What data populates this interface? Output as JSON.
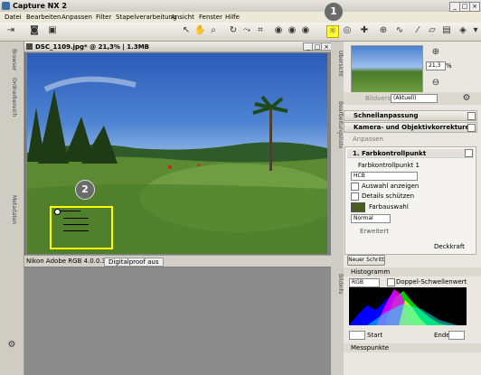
{
  "app": {
    "title": "Capture NX 2"
  },
  "menu": [
    "Datei",
    "Bearbeiten",
    "Anpassen",
    "Filter",
    "Stapelverarbeitung",
    "Ansicht",
    "Fenster",
    "Hilfe"
  ],
  "left_tabs": {
    "browser": "Browser",
    "ordnerbereich": "Ordnerbereich",
    "metadaten": "Metadaten"
  },
  "document": {
    "title": "DSC_1109.jpg* @ 21,3% | 1.3MB",
    "status_profile": "Nikon Adobe RGB 4.0.0.3000",
    "status_proof": "Digitalproof aus"
  },
  "callouts": {
    "one": "1",
    "two": "2"
  },
  "right_tabs": {
    "uebersicht": "Übersicht",
    "bearbeitungsliste": "Bearbeitungsliste",
    "bildinfo": "Bildinfo"
  },
  "overview": {
    "zoom": "21,3",
    "zoom_unit": "%"
  },
  "edit_list": {
    "version_label": "Bildversion",
    "version_value": "(Aktuell)",
    "schnellanpassung": "Schnellanpassung",
    "kamera": "Kamera- und Objektivkorrekturen",
    "anpassen": "Anpassen",
    "step_title": "1. Farbkontrollpunkt",
    "control_point": "Farbkontrollpunkt 1",
    "mode": "HCB",
    "auswahl": "Auswahl anzeigen",
    "details": "Details schützen",
    "farbauswahl": "Farbauswahl",
    "blend": "Normal",
    "erweitert": "Erweitert",
    "deckkraft": "Deckkraft",
    "new_step": "Neuer Schritt",
    "farbauswahl_color": "#4a5e22"
  },
  "histogram": {
    "title": "Histogramm",
    "channel": "RGB",
    "doppel": "Doppel-Schwellenwert",
    "start": "Start",
    "ende": "Ende"
  },
  "messpunkte": "Messpunkte"
}
